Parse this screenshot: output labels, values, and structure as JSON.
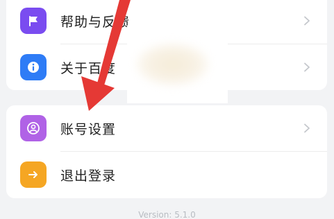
{
  "menu_groups": [
    {
      "items": [
        {
          "label": "帮助与反馈",
          "icon": "flag-icon",
          "icon_color": "#7a4cf0"
        },
        {
          "label": "关于百度",
          "icon": "info-icon",
          "icon_color": "#2e7cf6"
        }
      ]
    },
    {
      "items": [
        {
          "label": "账号设置",
          "icon": "user-circle-icon",
          "icon_color": "#b062e6"
        },
        {
          "label": "退出登录",
          "icon": "arrow-right-icon",
          "icon_color": "#f5a623"
        }
      ]
    }
  ],
  "version_text": "Version: 5.1.0",
  "colors": {
    "background": "#f2f3f5",
    "card": "#ffffff",
    "annotation_arrow": "#e53935"
  }
}
